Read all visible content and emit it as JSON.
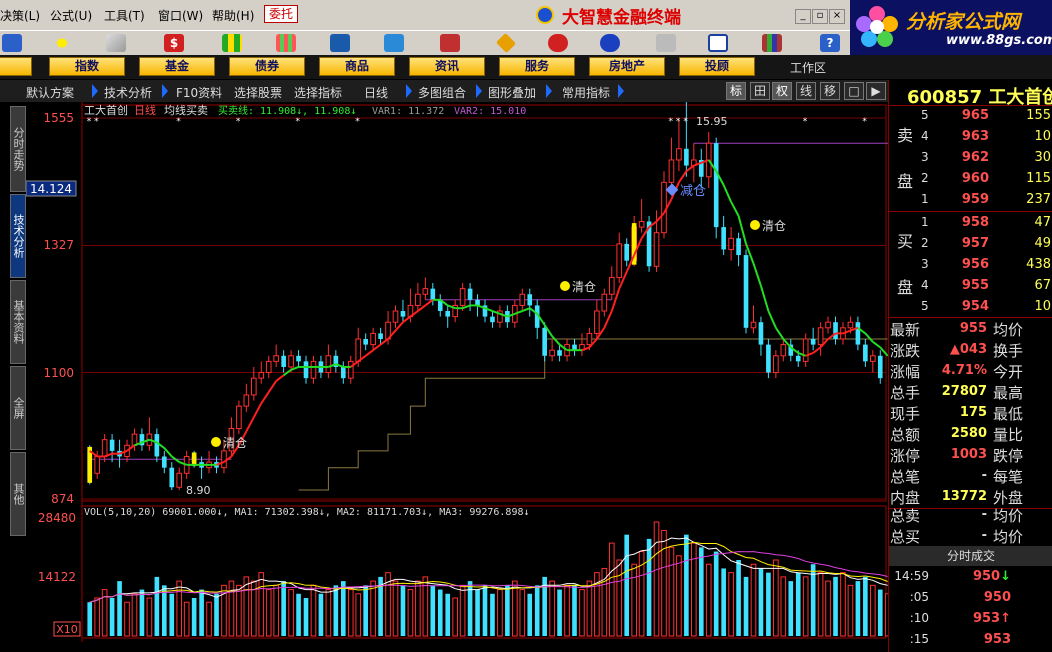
{
  "menu": {
    "items": [
      "决策(L)",
      "公式(U)",
      "工具(T)",
      "窗口(W)",
      "帮助(H)"
    ],
    "wt_button": "委托"
  },
  "app": {
    "title": "大智慧金融终端"
  },
  "brand": {
    "name": "分析家公式网",
    "url": "www.88gs.com"
  },
  "categories": [
    "股",
    "指数",
    "基金",
    "债券",
    "商品",
    "资讯",
    "服务",
    "房地产",
    "投顾"
  ],
  "workarea_label": "工作区",
  "subtoolbar": {
    "items": [
      "默认方案",
      "技术分析",
      "F10资料",
      "选择股票",
      "选择指标",
      "日线",
      "多图组合",
      "图形叠加",
      "常用指标"
    ],
    "buttons": [
      "标",
      "田",
      "权",
      "线",
      "移"
    ]
  },
  "sidetabs": [
    "分时走势",
    "技术分析",
    "基本资料",
    "全屏",
    "其他"
  ],
  "stock": {
    "code": "600857",
    "name": "工大首创"
  },
  "chart_data": {
    "type": "candlestick",
    "header": {
      "stock_name": "工大首创",
      "period": "日线",
      "indicator": "均线买卖",
      "line_a": "买卖线: 11.908↓, 11.908↓",
      "line_b": "VAR1: 11.372",
      "line_c": "VAR2: 15.010"
    },
    "ylim": [
      8.74,
      15.55
    ],
    "price_ticks": [
      "1555",
      "1327",
      "1100",
      "874"
    ],
    "crosshair_value": "14.124",
    "hi_label": "15.95",
    "lo_label": "8.90",
    "annotations": [
      "清仓",
      "清仓",
      "减仓",
      "清仓"
    ],
    "candles": [
      [
        9.6,
        9.1,
        9.7,
        9.0
      ],
      [
        9.2,
        9.5,
        9.6,
        9.1
      ],
      [
        9.5,
        9.8,
        9.9,
        9.4
      ],
      [
        9.8,
        9.6,
        9.9,
        9.4
      ],
      [
        9.6,
        9.5,
        9.8,
        9.3
      ],
      [
        9.5,
        9.7,
        9.8,
        9.4
      ],
      [
        9.7,
        9.9,
        10.0,
        9.6
      ],
      [
        9.9,
        9.7,
        10.0,
        9.6
      ],
      [
        9.7,
        9.9,
        10.2,
        9.6
      ],
      [
        9.9,
        9.5,
        10.0,
        9.4
      ],
      [
        9.5,
        9.3,
        9.6,
        9.2
      ],
      [
        9.3,
        8.95,
        9.4,
        8.9
      ],
      [
        8.95,
        9.2,
        9.3,
        8.9
      ],
      [
        9.2,
        9.5,
        9.6,
        9.1
      ],
      [
        9.5,
        9.4,
        9.6,
        9.3
      ],
      [
        9.4,
        9.3,
        9.5,
        9.1
      ],
      [
        9.3,
        9.4,
        9.6,
        9.2
      ],
      [
        9.4,
        9.3,
        9.5,
        9.2
      ],
      [
        9.3,
        9.6,
        9.8,
        9.2
      ],
      [
        9.6,
        10.0,
        10.2,
        9.5
      ],
      [
        10.0,
        10.4,
        10.5,
        9.9
      ],
      [
        10.4,
        10.6,
        10.8,
        10.3
      ],
      [
        10.6,
        10.9,
        11.1,
        10.5
      ],
      [
        10.9,
        11.0,
        11.2,
        10.8
      ],
      [
        11.0,
        11.2,
        11.3,
        10.9
      ],
      [
        11.2,
        11.3,
        11.5,
        11.1
      ],
      [
        11.3,
        11.1,
        11.4,
        11.0
      ],
      [
        11.1,
        11.3,
        11.4,
        11.0
      ],
      [
        11.3,
        11.2,
        11.4,
        11.1
      ],
      [
        11.2,
        10.9,
        11.3,
        10.8
      ],
      [
        10.9,
        11.2,
        11.3,
        10.8
      ],
      [
        11.2,
        11.0,
        11.3,
        10.9
      ],
      [
        11.0,
        11.3,
        11.5,
        10.9
      ],
      [
        11.3,
        11.1,
        11.4,
        11.0
      ],
      [
        11.1,
        10.9,
        11.2,
        10.8
      ],
      [
        10.9,
        11.2,
        11.3,
        10.8
      ],
      [
        11.2,
        11.6,
        11.8,
        11.1
      ],
      [
        11.6,
        11.5,
        11.7,
        11.4
      ],
      [
        11.5,
        11.7,
        11.8,
        11.4
      ],
      [
        11.7,
        11.6,
        11.8,
        11.5
      ],
      [
        11.6,
        11.9,
        12.1,
        11.5
      ],
      [
        11.9,
        12.1,
        12.2,
        11.8
      ],
      [
        12.1,
        12.0,
        12.3,
        11.9
      ],
      [
        12.0,
        12.2,
        12.5,
        11.9
      ],
      [
        12.2,
        12.4,
        12.6,
        12.1
      ],
      [
        12.4,
        12.5,
        12.7,
        12.3
      ],
      [
        12.5,
        12.3,
        12.6,
        12.2
      ],
      [
        12.3,
        12.1,
        12.4,
        12.0
      ],
      [
        12.1,
        12.0,
        12.2,
        11.8
      ],
      [
        12.0,
        12.2,
        12.3,
        11.9
      ],
      [
        12.2,
        12.5,
        12.6,
        12.1
      ],
      [
        12.5,
        12.3,
        12.6,
        12.1
      ],
      [
        12.3,
        12.2,
        12.4,
        12.0
      ],
      [
        12.2,
        12.0,
        12.3,
        11.9
      ],
      [
        12.0,
        11.9,
        12.1,
        11.8
      ],
      [
        11.9,
        12.1,
        12.2,
        11.8
      ],
      [
        12.1,
        11.9,
        12.2,
        11.8
      ],
      [
        11.9,
        12.2,
        12.3,
        11.8
      ],
      [
        12.2,
        12.4,
        12.5,
        12.1
      ],
      [
        12.4,
        12.2,
        12.5,
        12.0
      ],
      [
        12.2,
        11.8,
        12.3,
        11.6
      ],
      [
        11.8,
        11.3,
        11.9,
        11.2
      ],
      [
        11.3,
        11.4,
        11.6,
        11.2
      ],
      [
        11.4,
        11.3,
        11.5,
        11.2
      ],
      [
        11.3,
        11.5,
        11.6,
        11.2
      ],
      [
        11.5,
        11.4,
        11.6,
        11.3
      ],
      [
        11.4,
        11.5,
        11.7,
        11.3
      ],
      [
        11.5,
        11.7,
        11.8,
        11.4
      ],
      [
        11.7,
        12.1,
        12.3,
        11.6
      ],
      [
        12.1,
        12.4,
        12.5,
        12.0
      ],
      [
        12.4,
        12.7,
        12.9,
        12.3
      ],
      [
        12.7,
        13.3,
        13.5,
        12.6
      ],
      [
        13.3,
        13.0,
        13.4,
        12.9
      ],
      [
        13.0,
        13.6,
        13.8,
        12.9
      ],
      [
        13.6,
        13.7,
        14.1,
        13.5
      ],
      [
        13.7,
        12.9,
        13.8,
        12.8
      ],
      [
        12.9,
        13.5,
        13.9,
        12.8
      ],
      [
        13.5,
        14.4,
        14.6,
        13.4
      ],
      [
        14.4,
        14.8,
        15.2,
        14.3
      ],
      [
        14.8,
        15.0,
        15.5,
        14.6
      ],
      [
        15.0,
        14.7,
        15.95,
        14.5
      ],
      [
        14.7,
        14.8,
        15.1,
        14.4
      ],
      [
        14.8,
        14.5,
        15.0,
        14.3
      ],
      [
        14.5,
        15.1,
        15.3,
        14.3
      ],
      [
        15.1,
        13.6,
        15.2,
        13.4
      ],
      [
        13.6,
        13.2,
        13.8,
        13.1
      ],
      [
        13.2,
        13.4,
        13.6,
        13.0
      ],
      [
        13.4,
        13.1,
        13.5,
        12.9
      ],
      [
        13.1,
        11.8,
        13.2,
        11.7
      ],
      [
        11.8,
        11.9,
        12.2,
        11.7
      ],
      [
        11.9,
        11.5,
        12.0,
        11.3
      ],
      [
        11.5,
        11.0,
        11.6,
        10.9
      ],
      [
        11.0,
        11.3,
        11.4,
        10.9
      ],
      [
        11.3,
        11.5,
        11.6,
        11.2
      ],
      [
        11.5,
        11.3,
        11.6,
        11.2
      ],
      [
        11.3,
        11.2,
        11.4,
        11.1
      ],
      [
        11.2,
        11.6,
        11.7,
        11.1
      ],
      [
        11.6,
        11.5,
        11.8,
        11.4
      ],
      [
        11.5,
        11.8,
        11.9,
        11.3
      ],
      [
        11.8,
        11.9,
        12.0,
        11.7
      ],
      [
        11.9,
        11.6,
        12.0,
        11.5
      ],
      [
        11.6,
        11.8,
        11.9,
        11.5
      ],
      [
        11.8,
        11.9,
        12.0,
        11.7
      ],
      [
        11.9,
        11.5,
        12.0,
        11.4
      ],
      [
        11.5,
        11.2,
        11.6,
        11.1
      ],
      [
        11.2,
        11.3,
        11.4,
        11.0
      ],
      [
        11.3,
        10.9,
        11.4,
        10.8
      ]
    ],
    "ma_line": [
      9.6,
      9.5,
      9.5,
      9.55,
      9.55,
      9.6,
      9.7,
      9.75,
      9.8,
      9.75,
      9.65,
      9.5,
      9.4,
      9.35,
      9.35,
      9.35,
      9.35,
      9.35,
      9.4,
      9.5,
      9.7,
      9.95,
      10.2,
      10.45,
      10.65,
      10.85,
      10.95,
      11.05,
      11.1,
      11.1,
      11.1,
      11.1,
      11.1,
      11.15,
      11.1,
      11.1,
      11.2,
      11.3,
      11.4,
      11.5,
      11.6,
      11.75,
      11.9,
      12.0,
      12.1,
      12.2,
      12.3,
      12.3,
      12.2,
      12.15,
      12.15,
      12.2,
      12.2,
      12.15,
      12.1,
      12.05,
      12.0,
      12.05,
      12.1,
      12.15,
      12.05,
      11.85,
      11.65,
      11.5,
      11.4,
      11.4,
      11.4,
      11.45,
      11.6,
      11.8,
      12.1,
      12.5,
      12.8,
      13.1,
      13.4,
      13.6,
      13.7,
      13.85,
      14.1,
      14.4,
      14.6,
      14.7,
      14.75,
      14.8,
      14.6,
      14.35,
      14.05,
      13.8,
      13.3,
      12.95,
      12.55,
      12.1,
      11.8,
      11.6,
      11.45,
      11.35,
      11.3,
      11.35,
      11.45,
      11.6,
      11.7,
      11.7,
      11.75,
      11.8,
      11.7,
      11.55,
      11.45,
      11.3
    ],
    "ma_trend": [
      "red",
      "red",
      "red",
      "red",
      "red",
      "red",
      "green",
      "green",
      "green",
      "green",
      "green",
      "green",
      "green",
      "green",
      "green",
      "green",
      "green",
      "red",
      "red",
      "red",
      "red",
      "red",
      "red",
      "red",
      "red",
      "red",
      "green",
      "green",
      "green",
      "green",
      "green",
      "green",
      "green",
      "green",
      "green",
      "red",
      "red",
      "red",
      "red",
      "red",
      "red",
      "red",
      "red",
      "red",
      "red",
      "red",
      "green",
      "green",
      "green",
      "green",
      "green",
      "green",
      "green",
      "green",
      "green",
      "green",
      "green",
      "green",
      "green",
      "green",
      "green",
      "green",
      "green",
      "green",
      "green",
      "green",
      "red",
      "red",
      "red",
      "red",
      "red",
      "red",
      "red",
      "red",
      "red",
      "red",
      "red",
      "red",
      "red",
      "red",
      "red",
      "red",
      "red",
      "green",
      "green",
      "green",
      "green",
      "green",
      "green",
      "green",
      "green",
      "green",
      "green",
      "green",
      "green",
      "green",
      "red",
      "red",
      "red",
      "red",
      "red",
      "red",
      "red",
      "green",
      "green",
      "green",
      "green"
    ],
    "stop_line": [
      null,
      null,
      null,
      null,
      null,
      null,
      null,
      null,
      null,
      null,
      null,
      null,
      null,
      null,
      null,
      null,
      null,
      null,
      null,
      null,
      null,
      null,
      null,
      null,
      null,
      null,
      null,
      null,
      8.9,
      8.9,
      8.9,
      8.9,
      9.3,
      9.3,
      9.3,
      9.3,
      9.6,
      9.6,
      9.6,
      9.6,
      9.9,
      9.9,
      9.9,
      10.4,
      10.4,
      10.9,
      10.9,
      10.9,
      10.9,
      10.9,
      10.9,
      10.9,
      10.9,
      10.9,
      10.9,
      10.9,
      10.9,
      10.9,
      10.9,
      10.9,
      10.9,
      11.6,
      11.6,
      11.6,
      11.6,
      11.6,
      11.6,
      11.6,
      11.6,
      11.6,
      11.6,
      11.6,
      11.6,
      11.6,
      11.6,
      11.6,
      11.6,
      11.6,
      11.6,
      11.6,
      11.6,
      11.6,
      11.6,
      11.6,
      11.6,
      11.6,
      11.6,
      11.6,
      11.6,
      11.6,
      11.6,
      11.6,
      11.6,
      11.6,
      11.6,
      11.6,
      11.6,
      11.6,
      11.6,
      11.6,
      11.6,
      11.6,
      11.6,
      11.6,
      11.6,
      11.6,
      11.6,
      11.6
    ],
    "resistance_line": [
      9.45,
      9.45,
      9.45,
      9.45,
      9.45,
      9.45,
      9.45,
      9.45,
      9.45,
      9.45,
      9.45,
      9.45,
      9.45,
      9.45,
      9.45,
      9.45,
      9.45,
      9.45,
      9.45,
      9.45,
      null,
      null,
      null,
      null,
      null,
      null,
      null,
      null,
      null,
      null,
      null,
      null,
      null,
      null,
      null,
      null,
      null,
      null,
      null,
      null,
      null,
      null,
      null,
      null,
      null,
      12.3,
      12.3,
      12.3,
      12.3,
      12.3,
      12.3,
      12.3,
      12.3,
      12.3,
      12.3,
      12.3,
      12.3,
      12.3,
      12.3,
      12.3,
      12.3,
      12.3,
      12.3,
      12.3,
      12.3,
      12.3,
      12.3,
      12.3,
      12.3,
      12.3,
      12.3,
      null,
      null,
      null,
      null,
      null,
      null,
      null,
      null,
      null,
      null,
      15.1,
      15.1,
      15.1,
      15.1,
      15.1,
      15.1,
      15.1,
      15.1,
      15.1,
      15.1,
      15.1,
      15.1,
      15.1,
      15.1,
      15.1,
      15.1,
      15.1,
      15.1,
      15.1,
      15.1,
      15.1,
      15.1,
      15.1,
      15.1,
      15.1,
      15.1,
      15.1,
      15.1,
      15.1,
      15.1,
      15.1
    ],
    "volume": {
      "header": "VOL(5,10,20)  69001.000↓, MA1: 71302.398↓, MA2: 81171.703↓, MA3: 99276.898↓",
      "ylim": [
        0,
        28480
      ],
      "ticks": [
        "28480",
        "14122"
      ],
      "unit_label": "X10",
      "values": [
        8,
        9,
        11,
        9,
        13,
        8,
        10,
        11,
        9,
        14,
        12,
        10,
        13,
        8,
        9,
        11,
        8,
        10,
        12,
        13,
        12,
        14,
        13,
        15,
        11,
        12,
        13,
        11,
        10,
        9,
        12,
        10,
        11,
        12,
        13,
        11,
        10,
        12,
        13,
        14,
        15,
        13,
        12,
        11,
        13,
        14,
        12,
        11,
        10,
        9,
        12,
        13,
        11,
        12,
        10,
        11,
        12,
        13,
        11,
        10,
        12,
        14,
        13,
        11,
        12,
        12,
        11,
        13,
        15,
        16,
        22,
        18,
        24,
        17,
        20,
        23,
        27,
        25,
        21,
        19,
        24,
        22,
        21,
        17,
        20,
        16,
        15,
        18,
        14,
        17,
        16,
        15,
        18,
        14,
        13,
        15,
        14,
        17,
        15,
        13,
        14,
        15,
        12,
        13,
        14,
        12,
        11,
        10
      ]
    }
  },
  "quote": {
    "sell_label": [
      "卖",
      "盘"
    ],
    "buy_label": [
      "买",
      "盘"
    ],
    "asks": [
      [
        "5",
        "965",
        "155"
      ],
      [
        "4",
        "963",
        "10"
      ],
      [
        "3",
        "962",
        "30"
      ],
      [
        "2",
        "960",
        "115"
      ],
      [
        "1",
        "959",
        "237"
      ]
    ],
    "bids": [
      [
        "1",
        "958",
        "47"
      ],
      [
        "2",
        "957",
        "49"
      ],
      [
        "3",
        "956",
        "438"
      ],
      [
        "4",
        "955",
        "67"
      ],
      [
        "5",
        "954",
        "10"
      ]
    ],
    "stats": [
      [
        "最新",
        "955",
        "均价",
        "#ff5050"
      ],
      [
        "涨跌",
        "▲043",
        "换手",
        "#ff5050"
      ],
      [
        "涨幅",
        "4.71%",
        "今开",
        "#ff5050"
      ],
      [
        "总手",
        "27807",
        "最高",
        "#ffff55"
      ],
      [
        "现手",
        "175",
        "最低",
        "#ffff55"
      ],
      [
        "总额",
        "2580",
        "量比",
        "#ffff55"
      ],
      [
        "涨停",
        "1003",
        "跌停",
        "#ff5050"
      ],
      [
        "总笔",
        "-",
        "每笔",
        "#ddd"
      ],
      [
        "内盘",
        "13772",
        "外盘",
        "#ffff55"
      ]
    ],
    "extra": [
      [
        "总卖",
        "-",
        "均价"
      ],
      [
        "总买",
        "-",
        "均价"
      ]
    ],
    "ts_title": "分时成交",
    "ticks": [
      [
        "14:59",
        "950↓"
      ],
      [
        ":05",
        "950"
      ],
      [
        ":10",
        "953↑"
      ],
      [
        ":15",
        "953"
      ]
    ]
  }
}
